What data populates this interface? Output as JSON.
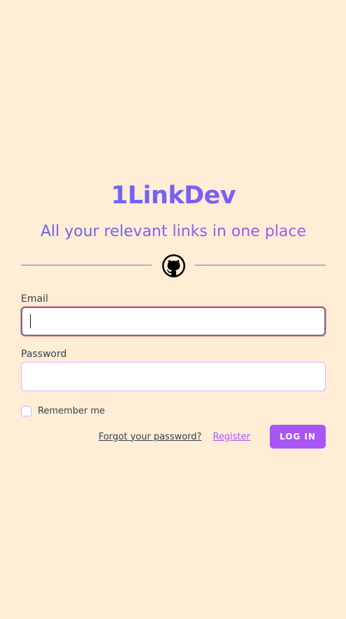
{
  "brand": {
    "title": "1LinkDev",
    "tagline": "All your relevant links in one place"
  },
  "divider": {
    "icon": "github-icon"
  },
  "form": {
    "email": {
      "label": "Email",
      "value": "",
      "placeholder": ""
    },
    "password": {
      "label": "Password",
      "value": "",
      "placeholder": ""
    },
    "remember_label": "Remember me",
    "forgot_label": "Forgot your password?",
    "register_label": "Register",
    "login_label": "LOG IN"
  },
  "colors": {
    "background": "#ffedd5",
    "accent": "#a855f7",
    "brand_start": "#6366f1"
  }
}
